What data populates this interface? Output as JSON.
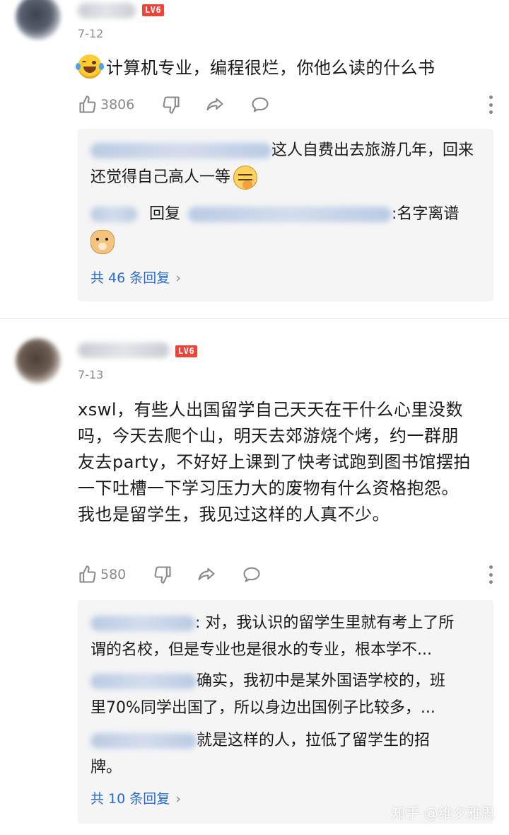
{
  "comments": [
    {
      "level_badge": "LV6",
      "date": "7-12",
      "text": "计算机专业，编程很烂，你他么读的什么书",
      "likes": "3806",
      "replies": {
        "items": [
          {
            "text": "这人自费出去旅游几年，回来还觉得自己高人一等"
          },
          {
            "reply_word": "回复",
            "text": ":名字离谱"
          }
        ],
        "more_label": "共 46 条回复"
      }
    },
    {
      "level_badge": "LV6",
      "date": "7-13",
      "text_lines": [
        "xswl，有些人出国留学自己天天在干什么心里没数",
        "吗，今天去爬个山，明天去郊游烧个烤，约一群朋",
        "友去party，不好好上课到了快考试跑到图书馆摆拍",
        "一下吐槽一下学习压力大的废物有什么资格抱怨。",
        "我也是留学生，我见过这样的人真不少。"
      ],
      "likes": "580",
      "replies": {
        "items": [
          {
            "line1": ": 对，我认识的留学生里就有考上了所",
            "line2": "谓的名校，但是专业也是很水的专业，根本学不..."
          },
          {
            "line1": "确实，我初中是某外国语学校的，班",
            "line2": "里70%同学出国了，所以身边出国例子比较多，..."
          },
          {
            "line1": "就是这样的人，拉低了留学生的招",
            "line2": "牌。"
          }
        ],
        "more_label": "共 10 条回复"
      }
    }
  ],
  "watermark": "知乎 @维夕雅思",
  "colors": {
    "accent_link": "#276ad6",
    "badge_red": "#f04438",
    "reply_bg": "#f5f5f6",
    "meta_gray": "#8a8a8a"
  },
  "icons": [
    "thumb-up-icon",
    "thumb-down-icon",
    "share-icon",
    "comment-icon",
    "more-icon",
    "chevron-right-icon",
    "laughing-tears-emoji",
    "thinking-emoji",
    "doge-emoji"
  ]
}
